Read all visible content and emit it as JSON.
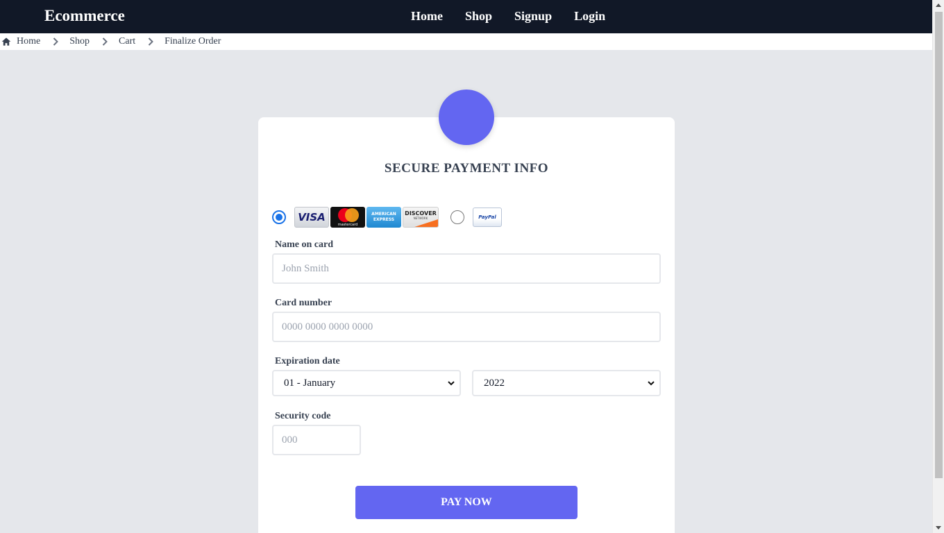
{
  "nav": {
    "brand": "Ecommerce",
    "links": [
      "Home",
      "Shop",
      "Signup",
      "Login"
    ]
  },
  "breadcrumb": {
    "items": [
      "Home",
      "Shop",
      "Cart",
      "Finalize Order"
    ]
  },
  "payment": {
    "title": "SECURE PAYMENT INFO",
    "methods": {
      "card_selected": true,
      "paypal_selected": false,
      "visa": "VISA",
      "mastercard": "mastercard",
      "amex_line1": "AMERICAN",
      "amex_line2": "EXPRESS",
      "discover": "DISCOVER",
      "discover_sub": "NETWORK",
      "paypal": "PayPal"
    },
    "name_label": "Name on card",
    "name_placeholder": "John Smith",
    "card_label": "Card number",
    "card_placeholder": "0000 0000 0000 0000",
    "expiry_label": "Expiration date",
    "month_value": "01 - January",
    "year_value": "2022",
    "cvc_label": "Security code",
    "cvc_placeholder": "000",
    "submit_label": "PAY NOW"
  },
  "colors": {
    "nav_bg": "#111827",
    "accent": "#6366f1",
    "page_bg": "#e5e7eb"
  }
}
